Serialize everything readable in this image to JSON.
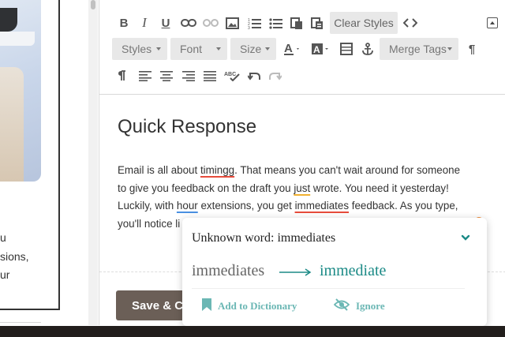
{
  "left_panel": {
    "text_lines": [
      "u",
      "sions,",
      "ur"
    ]
  },
  "toolbar": {
    "clear_styles_label": "Clear Styles",
    "styles_label": "Styles",
    "font_label": "Font",
    "size_label": "Size",
    "merge_tags_label": "Merge Tags",
    "icons": [
      "bold-icon",
      "italic-icon",
      "underline-icon",
      "link-icon",
      "unlink-icon",
      "image-icon",
      "numbered-list-icon",
      "bulleted-list-icon",
      "paste-icon",
      "paste-text-icon",
      "source-code-icon",
      "text-color-icon",
      "background-color-icon",
      "table-icon",
      "anchor-icon",
      "paragraph-mark-icon",
      "ltr-icon",
      "align-left-icon",
      "align-center-icon",
      "align-right-icon",
      "justify-icon",
      "spellcheck-icon",
      "undo-icon",
      "redo-icon",
      "collapse-icon"
    ]
  },
  "document": {
    "title": "Quick Response",
    "body": {
      "l1a": "Email is all about ",
      "l1w": "timingg",
      "l1b": ". That means you can't wait around for someone",
      "l2a": "to give you feedback on the draft you ",
      "l2w": "just",
      "l2b": " wrote. You need it yesterday!",
      "l3a": "Luckily, with ",
      "l3w": "hour",
      "l3b": " extensions, you get ",
      "l3w2": "immediates",
      "l3c": " feedback. As you type,",
      "l4a": "you'll notice li"
    }
  },
  "footer": {
    "save_label": "Save & C"
  },
  "spell_popup": {
    "heading": "Unknown word: immediates",
    "original": "immediates",
    "suggestion": "immediate",
    "add_label": "Add to Dictionary",
    "ignore_label": "Ignore"
  },
  "colors": {
    "accent_teal": "#1b8a86",
    "action_teal": "#6bb7b4",
    "misspelled_red": "#e74c3c",
    "grammar_orange": "#f0b030",
    "save_button": "#6b5f57"
  }
}
